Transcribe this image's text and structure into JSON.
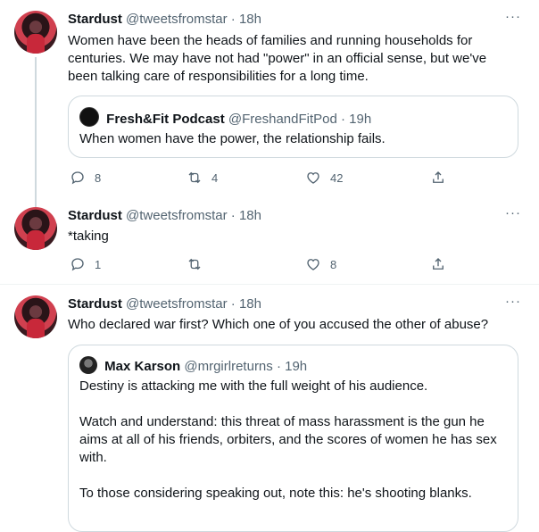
{
  "tweets": [
    {
      "name": "Stardust",
      "handle": "@tweetsfromstar",
      "time": "· 18h",
      "more": "···",
      "text": "Women have been the heads of families and running households for centuries. We may have not had \"power\" in an official sense, but we've been talking care of responsibilities for a long time.",
      "quote": {
        "name": "Fresh&Fit Podcast",
        "handle": "@FreshandFitPod",
        "time": "· 19h",
        "text": "When women have the power, the relationship fails."
      },
      "replies": "8",
      "retweets": "4",
      "likes": "42"
    },
    {
      "name": "Stardust",
      "handle": "@tweetsfromstar",
      "time": "· 18h",
      "more": "···",
      "text": "*taking",
      "replies": "1",
      "retweets": "",
      "likes": "8"
    },
    {
      "name": "Stardust",
      "handle": "@tweetsfromstar",
      "time": "· 18h",
      "more": "···",
      "text": "Who declared war first? Which one of you accused the other of abuse?",
      "quote": {
        "name": "Max Karson",
        "handle": "@mrgirlreturns",
        "time": "· 19h",
        "p1": "Destiny is attacking me with the full weight of his audience.",
        "p2": "Watch and understand: this threat of mass harassment is the gun he aims at all of his friends, orbiters, and the scores of women he has sex with.",
        "p3": "To those considering speaking out, note this: he's shooting blanks."
      }
    }
  ],
  "colors": {
    "accent": "#1d9bf0",
    "muted": "#536471",
    "border": "#cfd9de"
  }
}
